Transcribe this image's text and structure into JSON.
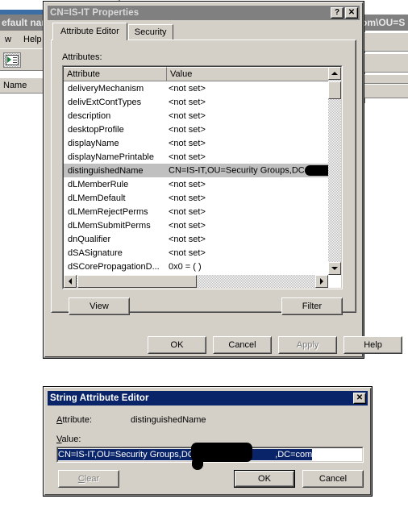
{
  "background": {
    "title_fragment": "efault nam",
    "menu_items": [
      "w",
      "Help"
    ],
    "toolbar_icon": "console-tree-icon",
    "column_header": "Name",
    "right_path_fragment": "om\\OU=S"
  },
  "properties_dialog": {
    "title": "CN=IS-IT Properties",
    "help_button": "?",
    "close_button": "✕",
    "tabs": [
      {
        "label": "Attribute Editor",
        "selected": true
      },
      {
        "label": "Security",
        "selected": false
      }
    ],
    "attributes_label": "Attributes:",
    "columns": [
      "Attribute",
      "Value"
    ],
    "rows": [
      {
        "attribute": "deliveryMechanism",
        "value": "<not set>",
        "selected": false,
        "redacted": false
      },
      {
        "attribute": "delivExtContTypes",
        "value": "<not set>",
        "selected": false,
        "redacted": false
      },
      {
        "attribute": "description",
        "value": "<not set>",
        "selected": false,
        "redacted": false
      },
      {
        "attribute": "desktopProfile",
        "value": "<not set>",
        "selected": false,
        "redacted": false
      },
      {
        "attribute": "displayName",
        "value": "<not set>",
        "selected": false,
        "redacted": false
      },
      {
        "attribute": "displayNamePrintable",
        "value": "<not set>",
        "selected": false,
        "redacted": false
      },
      {
        "attribute": "distinguishedName",
        "value": "CN=IS-IT,OU=Security Groups,DC",
        "selected": true,
        "redacted": true
      },
      {
        "attribute": "dLMemberRule",
        "value": "<not set>",
        "selected": false,
        "redacted": false
      },
      {
        "attribute": "dLMemDefault",
        "value": "<not set>",
        "selected": false,
        "redacted": false
      },
      {
        "attribute": "dLMemRejectPerms",
        "value": "<not set>",
        "selected": false,
        "redacted": false
      },
      {
        "attribute": "dLMemSubmitPerms",
        "value": "<not set>",
        "selected": false,
        "redacted": false
      },
      {
        "attribute": "dnQualifier",
        "value": "<not set>",
        "selected": false,
        "redacted": false
      },
      {
        "attribute": "dSASignature",
        "value": "<not set>",
        "selected": false,
        "redacted": false
      },
      {
        "attribute": "dSCorePropagationD...",
        "value": "0x0 = ( )",
        "selected": false,
        "redacted": false
      }
    ],
    "view_button": "View",
    "filter_button": "Filter",
    "ok_button": "OK",
    "cancel_button": "Cancel",
    "apply_button": "Apply",
    "help_label": "Help"
  },
  "string_editor_dialog": {
    "title": "String Attribute Editor",
    "close_button": "✕",
    "attribute_label": "Attribute:",
    "attribute_name": "distinguishedName",
    "value_label": "Value:",
    "value_prefix": "CN=IS-IT,OU=Security Groups,DC=",
    "value_suffix": ",DC=com",
    "clear_button": "Clear",
    "ok_button": "OK",
    "cancel_button": "Cancel"
  },
  "colors": {
    "face": "#d4d0c8",
    "active_title": "#0a246a",
    "inactive_title": "#808080",
    "selection": "#c0c0c0",
    "text_selection": "#0a246a",
    "redaction": "#000000"
  }
}
